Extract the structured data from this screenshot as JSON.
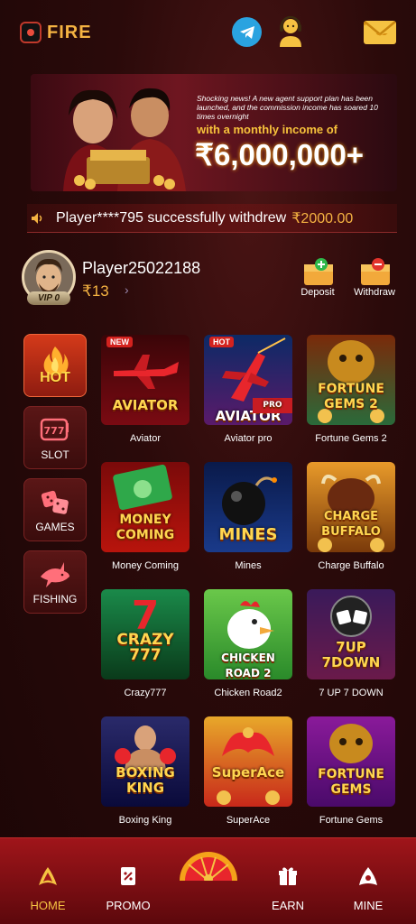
{
  "header": {
    "logo_text": "FIRE",
    "icons": [
      "telegram-icon",
      "support-agent-icon",
      "mail-icon"
    ]
  },
  "banner": {
    "small_text": "Shocking news! A new agent support plan has been launched, and the commission income has soared 10 times overnight",
    "gold_text": "with a monthly income of",
    "amount": "₹6,000,000+"
  },
  "ticker": {
    "message": "Player****795 successfully withdrew",
    "amount": "₹2000.00"
  },
  "user": {
    "name": "Player25022188",
    "balance": "₹13",
    "vip": "VIP 0"
  },
  "actions": {
    "deposit": "Deposit",
    "withdraw": "Withdraw"
  },
  "categories": [
    {
      "label": "HOT",
      "active": true
    },
    {
      "label": "SLOT",
      "active": false
    },
    {
      "label": "GAMES",
      "active": false
    },
    {
      "label": "FISHING",
      "active": false
    }
  ],
  "games": [
    {
      "name": "Aviator",
      "thumb_title": "AVIATOR",
      "badge": "NEW"
    },
    {
      "name": "Aviator pro",
      "thumb_title": "AVIATOR",
      "badge": "HOT",
      "sub": "PRO"
    },
    {
      "name": "Fortune Gems 2",
      "thumb_title": "FORTUNE GEMS 2"
    },
    {
      "name": "Money Coming",
      "thumb_title": "MONEY COMING"
    },
    {
      "name": "Mines",
      "thumb_title": "MINES"
    },
    {
      "name": "Charge Buffalo",
      "thumb_title": "CHARGE BUFFALO"
    },
    {
      "name": "Crazy777",
      "thumb_title": "CRAZY 777"
    },
    {
      "name": "Chicken Road2",
      "thumb_title": "CHICKEN ROAD 2"
    },
    {
      "name": "7 UP 7 DOWN",
      "thumb_title": "7UP 7DOWN"
    },
    {
      "name": "Boxing King",
      "thumb_title": "BOXING KING"
    },
    {
      "name": "SuperAce",
      "thumb_title": "SuperAce"
    },
    {
      "name": "Fortune Gems",
      "thumb_title": "FORTUNE GEMS"
    }
  ],
  "nav": [
    {
      "label": "HOME",
      "active": true
    },
    {
      "label": "PROMO",
      "active": false
    },
    {
      "label": "EARN",
      "active": false
    },
    {
      "label": "MINE",
      "active": false
    }
  ],
  "colors": {
    "accent": "#f5b342",
    "nav_bg": "#a0151a",
    "bg": "#2a0a0a"
  }
}
